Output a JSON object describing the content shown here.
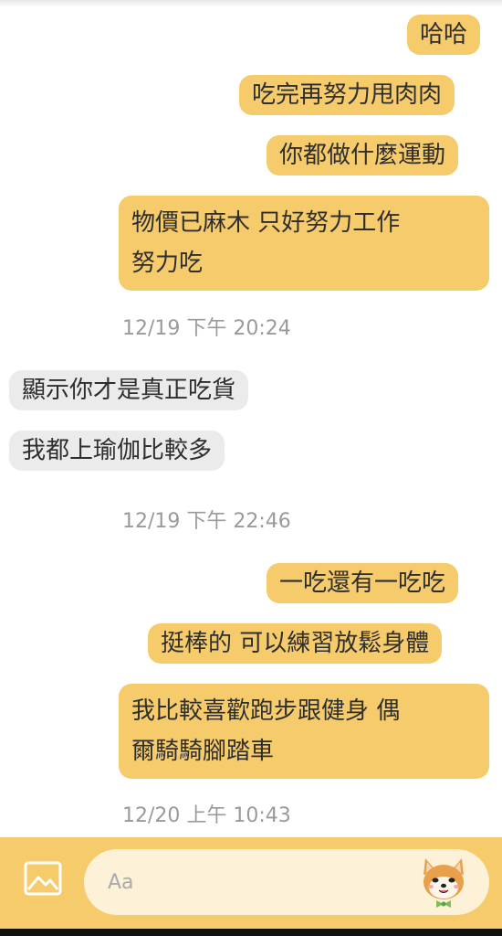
{
  "messages": {
    "m1": "哈哈",
    "m2": "吃完再努力甩肉肉",
    "m3": "你都做什麼運動",
    "m4": [
      "物價已麻木 只好努力工作",
      "努力吃"
    ],
    "m5": "顯示你才是真正吃貨",
    "m6": "我都上瑜伽比較多",
    "m7": "一吃還有一吃吃",
    "m8": "挺棒的 可以練習放鬆身體",
    "m9": [
      "我比較喜歡跑步跟健身 偶",
      "爾騎騎腳踏車"
    ]
  },
  "timestamps": {
    "t1": "12/19 下午 20:24",
    "t2": "12/19 下午 22:46",
    "t3": "12/20 上午 10:43"
  },
  "composer": {
    "placeholder": "Aa",
    "image_icon": "image-icon",
    "sticker_icon": "shiba-dog-sticker-icon"
  },
  "colors": {
    "outgoing_bubble": "#f6cb6c",
    "incoming_bubble": "#ebebeb",
    "composer_bar": "#f6cb6c",
    "input_bg": "#fdf2d8",
    "timestamp_text": "#9a9a9a"
  }
}
